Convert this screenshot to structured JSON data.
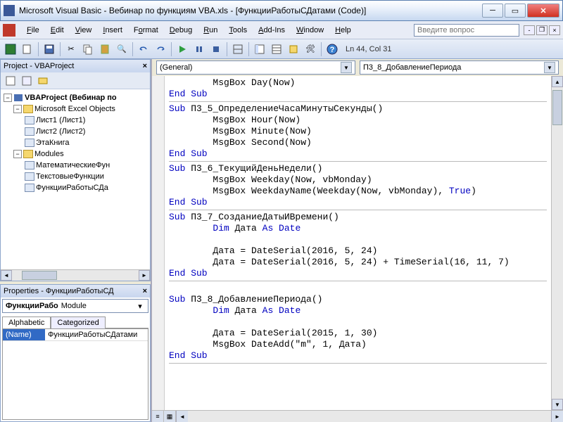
{
  "window": {
    "title": "Microsoft Visual Basic - Вебинар по функциям VBA.xls - [ФункцииРаботыСДатами (Code)]"
  },
  "menu": {
    "file": "File",
    "edit": "Edit",
    "view": "View",
    "insert": "Insert",
    "format": "Format",
    "debug": "Debug",
    "run": "Run",
    "tools": "Tools",
    "addins": "Add-Ins",
    "window": "Window",
    "help": "Help",
    "search_placeholder": "Введите вопрос"
  },
  "toolbar": {
    "status": "Ln 44, Col 31"
  },
  "project_panel": {
    "title": "Project - VBAProject",
    "tree": {
      "root": "VBAProject (Вебинар по",
      "excel_objects": "Microsoft Excel Objects",
      "sheet1": "Лист1 (Лист1)",
      "sheet2": "Лист2 (Лист2)",
      "workbook": "ЭтаКнига",
      "modules": "Modules",
      "mod1": "МатематическиеФун",
      "mod2": "ТекстовыеФункции",
      "mod3": "ФункцииРаботыСДа"
    }
  },
  "props_panel": {
    "title": "Properties - ФункцииРаботыСД",
    "combo_name": "ФункцииРабо",
    "combo_type": "Module",
    "tab_alpha": "Alphabetic",
    "tab_cat": "Categorized",
    "name_key": "(Name)",
    "name_val": "ФункцииРаботыСДатами"
  },
  "code": {
    "combo_left": "(General)",
    "combo_right": "П3_8_ДобавлениеПериода",
    "lines": [
      {
        "i": 2,
        "t": "MsgBox Day(Now)"
      },
      {
        "i": 0,
        "k": "End Sub"
      },
      {
        "hr": true
      },
      {
        "i": 0,
        "pre": "Sub",
        "t": " П3_5_ОпределениеЧасаМинутыСекунды()"
      },
      {
        "i": 2,
        "t": "MsgBox Hour(Now)"
      },
      {
        "i": 2,
        "t": "MsgBox Minute(Now)"
      },
      {
        "i": 2,
        "t": "MsgBox Second(Now)"
      },
      {
        "i": 0,
        "k": "End Sub"
      },
      {
        "hr": true
      },
      {
        "i": 0,
        "pre": "Sub",
        "t": " П3_6_ТекущийДеньНедели()"
      },
      {
        "i": 2,
        "t": "MsgBox Weekday(Now, vbMonday)"
      },
      {
        "i": 2,
        "t": "MsgBox WeekdayName(Weekday(Now, vbMonday), ",
        "k2": "True",
        "t2": ")"
      },
      {
        "i": 0,
        "k": "End Sub"
      },
      {
        "hr": true
      },
      {
        "i": 0,
        "pre": "Sub",
        "t": " П3_7_СозданиеДатыИВремени()"
      },
      {
        "i": 2,
        "pre": "Dim",
        "t": " Дата ",
        "k2": "As Date"
      },
      {
        "blank": true
      },
      {
        "i": 2,
        "t": "Дата = DateSerial(2016, 5, 24)"
      },
      {
        "i": 2,
        "t": "Дата = DateSerial(2016, 5, 24) + TimeSerial(16, 11, 7)"
      },
      {
        "i": 0,
        "k": "End Sub"
      },
      {
        "hr": true
      },
      {
        "blank": true
      },
      {
        "i": 0,
        "pre": "Sub",
        "t": " П3_8_ДобавлениеПериода()"
      },
      {
        "i": 2,
        "pre": "Dim",
        "t": " Дата ",
        "k2": "As Date"
      },
      {
        "blank": true
      },
      {
        "i": 2,
        "t": "Дата = DateSerial(2015, 1, 30)"
      },
      {
        "i": 2,
        "t": "MsgBox DateAdd(\"m\", 1, Дата)"
      },
      {
        "i": 0,
        "k": "End Sub"
      },
      {
        "hr": true
      }
    ]
  }
}
